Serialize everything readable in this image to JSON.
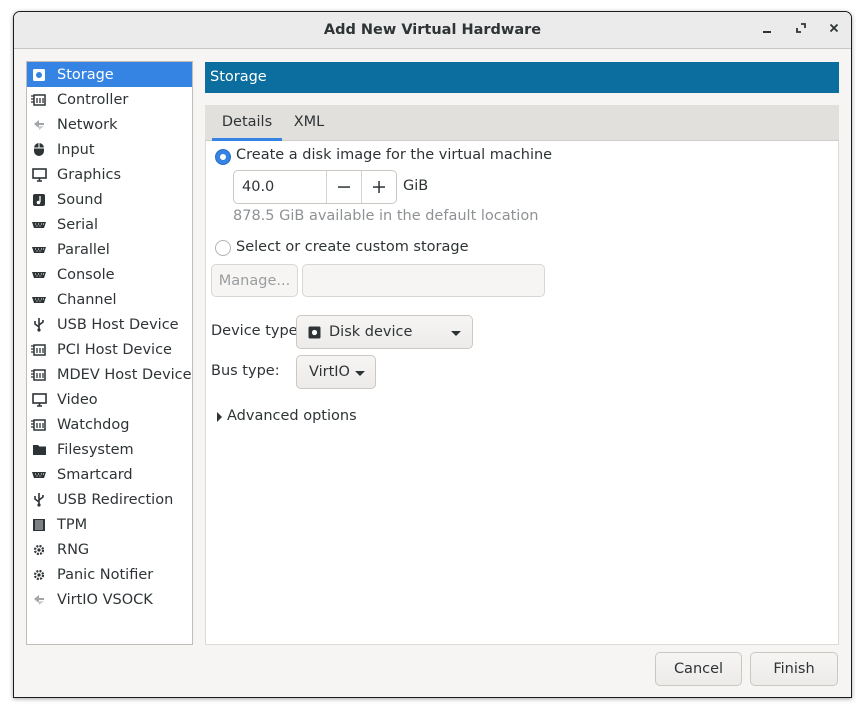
{
  "window": {
    "title": "Add New Virtual Hardware"
  },
  "window_controls": [
    "minimize-icon",
    "maximize-icon",
    "close-icon"
  ],
  "sidebar": {
    "items": [
      {
        "label": "Storage",
        "icon": "disk-icon",
        "selected": true
      },
      {
        "label": "Controller",
        "icon": "chip-icon"
      },
      {
        "label": "Network",
        "icon": "network-icon"
      },
      {
        "label": "Input",
        "icon": "mouse-icon"
      },
      {
        "label": "Graphics",
        "icon": "monitor-icon"
      },
      {
        "label": "Sound",
        "icon": "audio-icon"
      },
      {
        "label": "Serial",
        "icon": "serial-port-icon"
      },
      {
        "label": "Parallel",
        "icon": "serial-port-icon"
      },
      {
        "label": "Console",
        "icon": "serial-port-icon"
      },
      {
        "label": "Channel",
        "icon": "serial-port-icon"
      },
      {
        "label": "USB Host Device",
        "icon": "usb-icon"
      },
      {
        "label": "PCI Host Device",
        "icon": "chip-icon"
      },
      {
        "label": "MDEV Host Device",
        "icon": "chip-icon"
      },
      {
        "label": "Video",
        "icon": "monitor-icon"
      },
      {
        "label": "Watchdog",
        "icon": "chip-icon"
      },
      {
        "label": "Filesystem",
        "icon": "folder-icon"
      },
      {
        "label": "Smartcard",
        "icon": "serial-port-icon"
      },
      {
        "label": "USB Redirection",
        "icon": "usb-icon"
      },
      {
        "label": "TPM",
        "icon": "tpm-chip-icon"
      },
      {
        "label": "RNG",
        "icon": "gear-icon"
      },
      {
        "label": "Panic Notifier",
        "icon": "gear-icon"
      },
      {
        "label": "VirtIO VSOCK",
        "icon": "network-icon"
      }
    ]
  },
  "main": {
    "header": "Storage",
    "tabs": [
      {
        "label": "Details",
        "active": true
      },
      {
        "label": "XML",
        "active": false
      }
    ],
    "create_disk_label": "Create a disk image for the virtual machine",
    "size_value": "40.0",
    "size_unit": "GiB",
    "available_text": "878.5 GiB available in the default location",
    "custom_storage_label": "Select or create custom storage",
    "manage_button": "Manage...",
    "custom_path_value": "",
    "device_type_label": "Device type:",
    "device_type_value": "Disk device",
    "bus_type_label": "Bus type:",
    "bus_type_value": "VirtIO",
    "advanced_label": "Advanced options"
  },
  "footer": {
    "cancel": "Cancel",
    "finish": "Finish"
  },
  "colors": {
    "accent": "#3584e4",
    "header_bar": "#0b6e9e"
  }
}
